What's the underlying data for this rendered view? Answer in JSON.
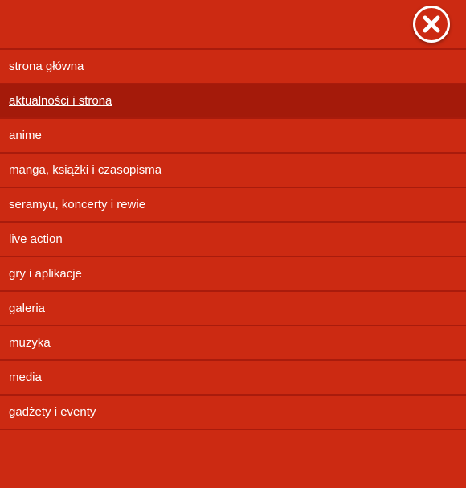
{
  "colors": {
    "background": "#cc2a12",
    "active_background": "#a41a0a",
    "divider": "#a91b0c",
    "text": "#ffffff"
  },
  "close_button": {
    "icon": "close-icon"
  },
  "menu": {
    "active_index": 1,
    "items": [
      {
        "label": "strona główna"
      },
      {
        "label": "aktualności i strona"
      },
      {
        "label": "anime"
      },
      {
        "label": "manga, książki i czasopisma"
      },
      {
        "label": "seramyu, koncerty i rewie"
      },
      {
        "label": "live action"
      },
      {
        "label": "gry i aplikacje"
      },
      {
        "label": "galeria"
      },
      {
        "label": "muzyka"
      },
      {
        "label": "media"
      },
      {
        "label": "gadżety i eventy"
      }
    ]
  }
}
